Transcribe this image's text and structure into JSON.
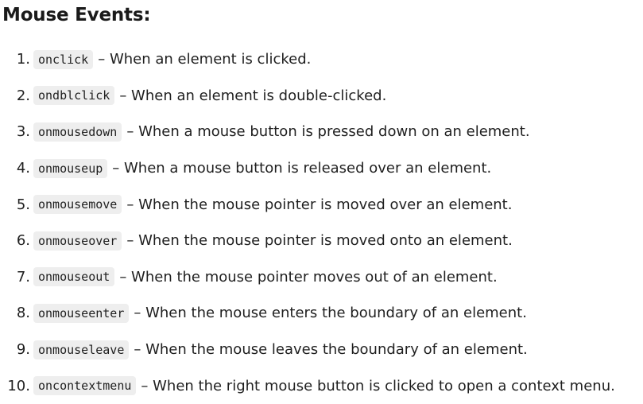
{
  "heading": "Mouse Events:",
  "events": [
    {
      "num": "1.",
      "code": "onclick",
      "desc": "– When an element is clicked."
    },
    {
      "num": "2.",
      "code": "ondblclick",
      "desc": "– When an element is double-clicked."
    },
    {
      "num": "3.",
      "code": "onmousedown",
      "desc": "– When a mouse button is pressed down on an element."
    },
    {
      "num": "4.",
      "code": "onmouseup",
      "desc": "– When a mouse button is released over an element."
    },
    {
      "num": "5.",
      "code": "onmousemove",
      "desc": "– When the mouse pointer is moved over an element."
    },
    {
      "num": "6.",
      "code": "onmouseover",
      "desc": "– When the mouse pointer is moved onto an element."
    },
    {
      "num": "7.",
      "code": "onmouseout",
      "desc": "– When the mouse pointer moves out of an element."
    },
    {
      "num": "8.",
      "code": "onmouseenter",
      "desc": "– When the mouse enters the boundary of an element."
    },
    {
      "num": "9.",
      "code": "onmouseleave",
      "desc": "– When the mouse leaves the boundary of an element."
    },
    {
      "num": "10.",
      "code": "oncontextmenu",
      "desc": "– When the right mouse button is clicked to open a context menu."
    }
  ]
}
